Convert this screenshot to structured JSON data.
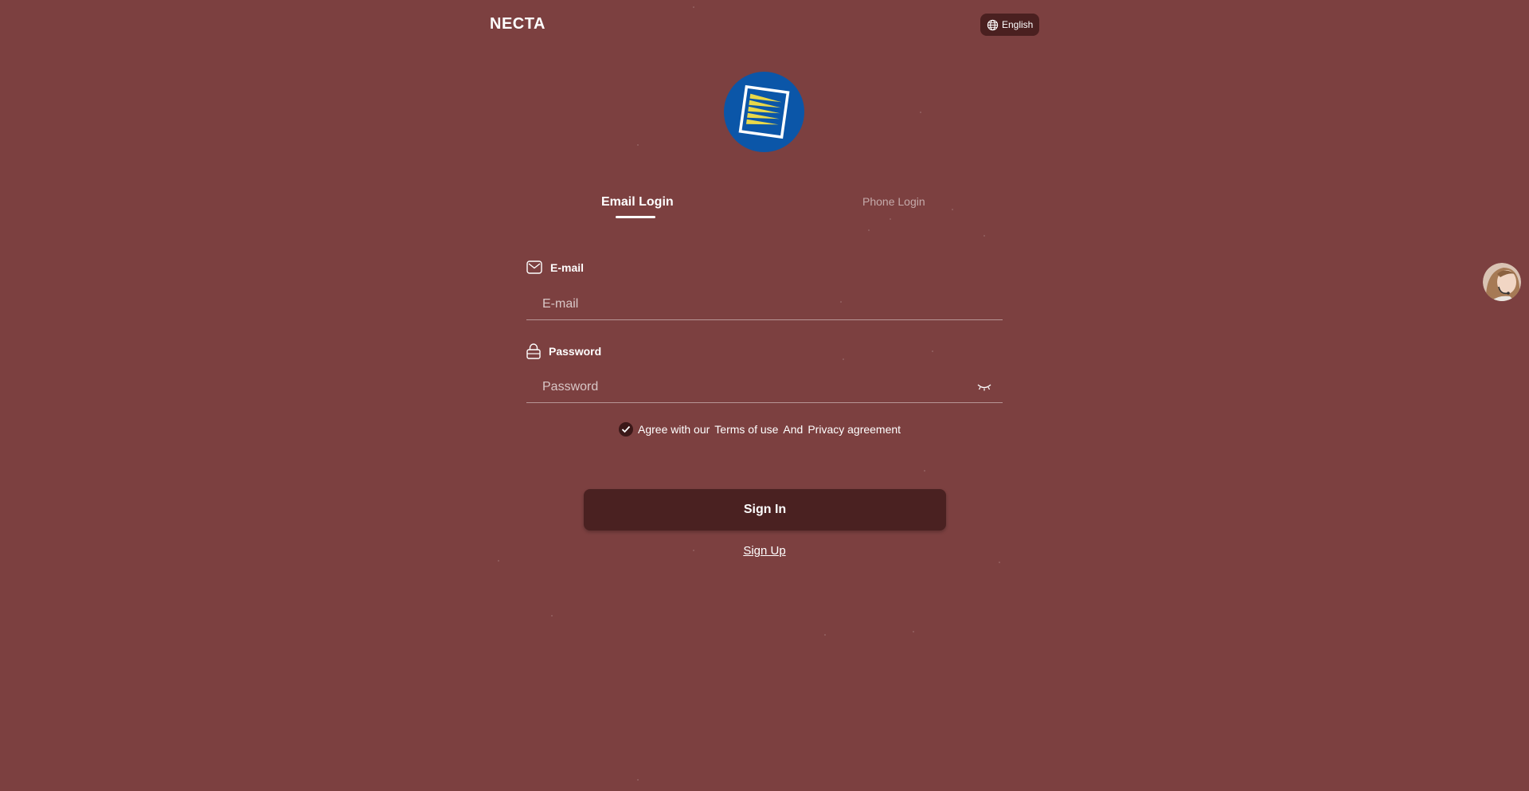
{
  "header": {
    "brand": "NECTA",
    "language_label": "English"
  },
  "tabs": [
    {
      "label": "Email Login",
      "active": true
    },
    {
      "label": "Phone Login",
      "active": false
    }
  ],
  "form": {
    "email_label": "E-mail",
    "email_placeholder": "E-mail",
    "email_value": "",
    "password_label": "Password",
    "password_placeholder": "Password",
    "password_value": ""
  },
  "agreement": {
    "checked": true,
    "prefix": "Agree with our",
    "terms": "Terms of use",
    "conjunction": "And",
    "privacy": "Privacy agreement"
  },
  "actions": {
    "sign_in": "Sign In",
    "sign_up": "Sign Up"
  },
  "colors": {
    "background": "#7c4040",
    "button": "#4a2121",
    "logo_blue": "#0b56a8",
    "logo_yellow": "#e8d84a"
  }
}
